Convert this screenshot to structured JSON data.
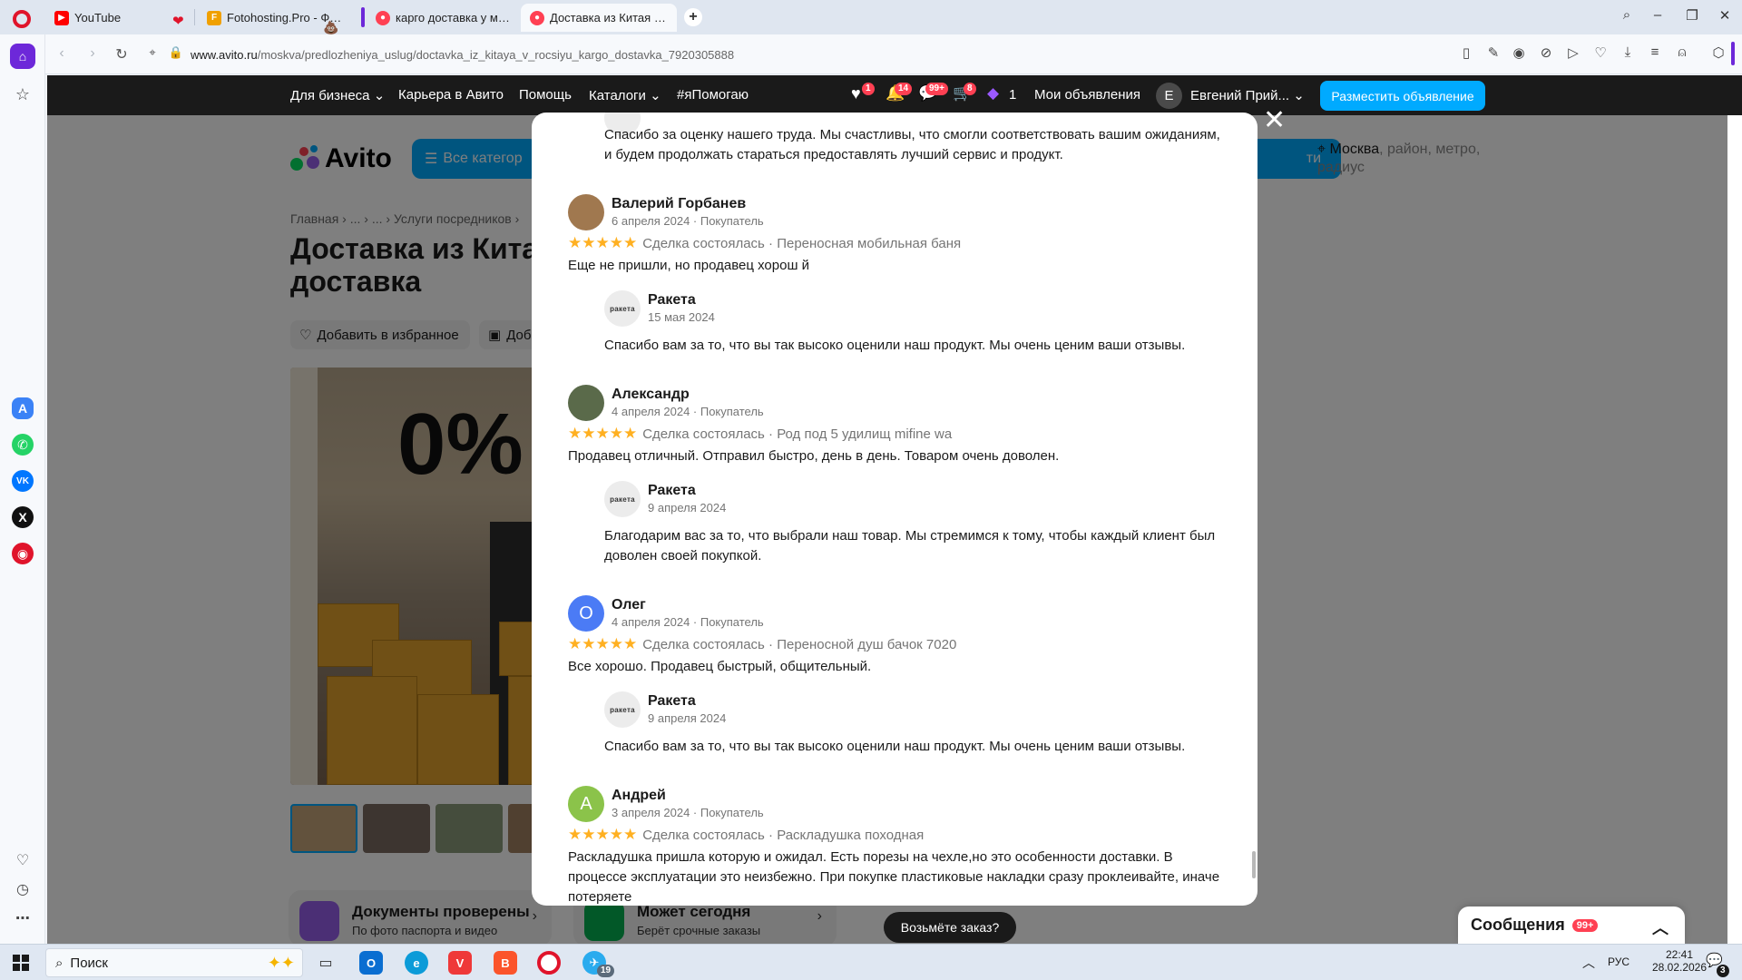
{
  "browser": {
    "tabs": [
      {
        "title": "YouTube",
        "favicon": "youtube-icon",
        "color": "#ff0000"
      },
      {
        "title": "Fotohosting.Pro - Фотохо",
        "favicon": "fotohosting-icon",
        "color": "#f0a000"
      },
      {
        "title": "карго доставка у метро А",
        "favicon": "avito-icon",
        "color": "#ff4053"
      },
      {
        "title": "Доставка из Китая в Росс",
        "favicon": "avito-icon",
        "color": "#ff4053"
      }
    ],
    "url_host": "www.avito.ru",
    "url_path": "/moskva/predlozheniya_uslug/doctavka_iz_kitaya_v_rocsiyu_kargo_dostavka_7920305888"
  },
  "avito": {
    "nav": {
      "business": "Для бизнеса",
      "career": "Карьера в Авито",
      "help": "Помощь",
      "catalogs": "Каталоги",
      "hashtag": "#яПомогаю",
      "favorites_badge": "1",
      "notifications_badge": "14",
      "messages_badge": "99+",
      "cart_badge": "8",
      "promo_count": "1",
      "my_ads": "Мои объявления",
      "user_initial": "Е",
      "user_name": "Евгений Прий...",
      "post_ad": "Разместить объявление"
    },
    "logo": "Avito",
    "all_categories": "Все категор",
    "search_button": "ти",
    "location_city": "Москва",
    "location_rest": ", район, метро, радиус",
    "breadcrumbs": "Главная  ›  ...  ›  ...  ›  Услуги посредников  ›",
    "title": "Доставка из Китая доставка",
    "add_favorite": "Добавить в избранное",
    "note_button": "Доб",
    "hero_text": "0%",
    "promo1_title": "Документы проверены",
    "promo1_sub": "По фото паспорта и видео",
    "promo2_title": "Может сегодня",
    "promo2_sub": "Берёт срочные заказы",
    "take_order": "Возьмёте заказ?",
    "messages": "Сообщения",
    "messages_badge": "99+"
  },
  "modal": {
    "top_reply": "Спасибо за оценку нашего труда. Мы счастливы, что смогли соответствовать вашим ожиданиям, и будем продолжать стараться предоставлять лучший сервис и продукт.",
    "reviews": [
      {
        "initial": "",
        "avatar_color": "#a0784f",
        "name": "Валерий Горбанев",
        "meta": "6 апреля 2024 · Покупатель",
        "stars": "★★★★★",
        "deal": "Сделка состоялась · Переносная мобильная баня",
        "text": "Еще не пришли, но продавец хорош й",
        "seller_logo": "ракета",
        "seller": "Ракета",
        "reply_date": "15 мая 2024",
        "reply": "Спасибо вам за то, что вы так высоко оценили наш продукт. Мы очень ценим ваши отзывы."
      },
      {
        "initial": "",
        "avatar_color": "#5a6a4a",
        "name": "Александр",
        "meta": "4 апреля 2024 · Покупатель",
        "stars": "★★★★★",
        "deal": "Сделка состоялась · Род под 5 удилищ mifine wa",
        "text": "Продавец отличный. Отправил быстро, день в день. Товаром очень доволен.",
        "seller_logo": "ракета",
        "seller": "Ракета",
        "reply_date": "9 апреля 2024",
        "reply": "Благодарим вас за то, что выбрали наш товар. Мы стремимся к тому, чтобы каждый клиент был доволен своей покупкой."
      },
      {
        "initial": "О",
        "avatar_color": "#4b7bf5",
        "name": "Олег",
        "meta": "4 апреля 2024 · Покупатель",
        "stars": "★★★★★",
        "deal": "Сделка состоялась · Переносной душ бачок 7020",
        "text": "Все хорошо. Продавец быстрый, общительный.",
        "seller_logo": "ракета",
        "seller": "Ракета",
        "reply_date": "9 апреля 2024",
        "reply": "Спасибо вам за то, что вы так высоко оценили наш продукт. Мы очень ценим ваши отзывы."
      },
      {
        "initial": "А",
        "avatar_color": "#8bc34a",
        "name": "Андрей",
        "meta": "3 апреля 2024 · Покупатель",
        "stars": "★★★★★",
        "deal": "Сделка состоялась · Раскладушка походная",
        "text": "Раскладушка пришла которую и ожидал. Есть порезы на чехле,но это особенности доставки. В процессе эксплуатации это неизбежно. При покупке пластиковые накладки сразу проклеивайте, иначе потеряете"
      }
    ]
  },
  "taskbar": {
    "search": "Поиск",
    "lang": "РУС",
    "time": "22:41",
    "date": "28.02.2026",
    "notif_count": "3",
    "telegram_badge": "19"
  }
}
